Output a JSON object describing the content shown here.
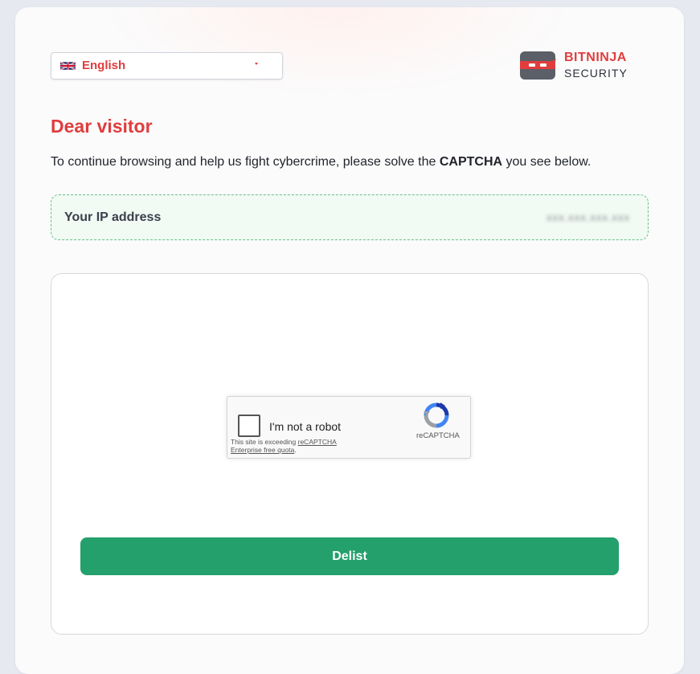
{
  "language": {
    "selected": "English",
    "flag_icon": "uk-flag-icon"
  },
  "logo": {
    "line1": "BITNINJA",
    "line2": "SECURITY"
  },
  "heading": "Dear visitor",
  "intro": {
    "before": "To continue browsing and help us fight cybercrime, please solve the ",
    "bold": "CAPTCHA",
    "after": " you see below."
  },
  "ip": {
    "label": "Your IP address",
    "value": "xxx.xxx.xxx.xxx"
  },
  "recaptcha": {
    "label": "I'm not a robot",
    "note_before": "This site is exceeding ",
    "note_link": "reCAPTCHA Enterprise free quota",
    "note_after": ".",
    "brand": "reCAPTCHA"
  },
  "delist_button": "Delist",
  "colors": {
    "accent": "#e03d3d",
    "button": "#23a06b",
    "ip_border": "#6cc08a"
  }
}
